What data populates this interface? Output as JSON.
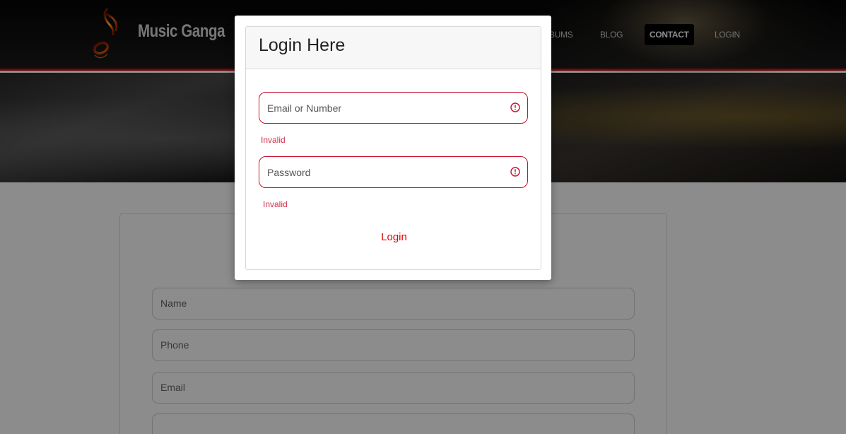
{
  "brand": {
    "name": "Music Ganga",
    "logo_icon": "music-note-fire-icon"
  },
  "nav": {
    "items": [
      {
        "label": "BUMS"
      },
      {
        "label": "BLOG"
      },
      {
        "label": "CONTACT",
        "active": true
      },
      {
        "label": "LOGIN"
      }
    ]
  },
  "contact_form": {
    "fields": [
      {
        "placeholder": "Name"
      },
      {
        "placeholder": "Phone"
      },
      {
        "placeholder": "Email"
      }
    ]
  },
  "login_modal": {
    "title": "Login Here",
    "email": {
      "placeholder": "Email or Number",
      "value": "",
      "error": "Invalid"
    },
    "password": {
      "placeholder": "Password",
      "value": "",
      "error": "Invalid"
    },
    "submit_label": "Login"
  },
  "colors": {
    "accent_red": "#c81010",
    "error_red": "#c8102e",
    "link_red": "#e00000"
  }
}
